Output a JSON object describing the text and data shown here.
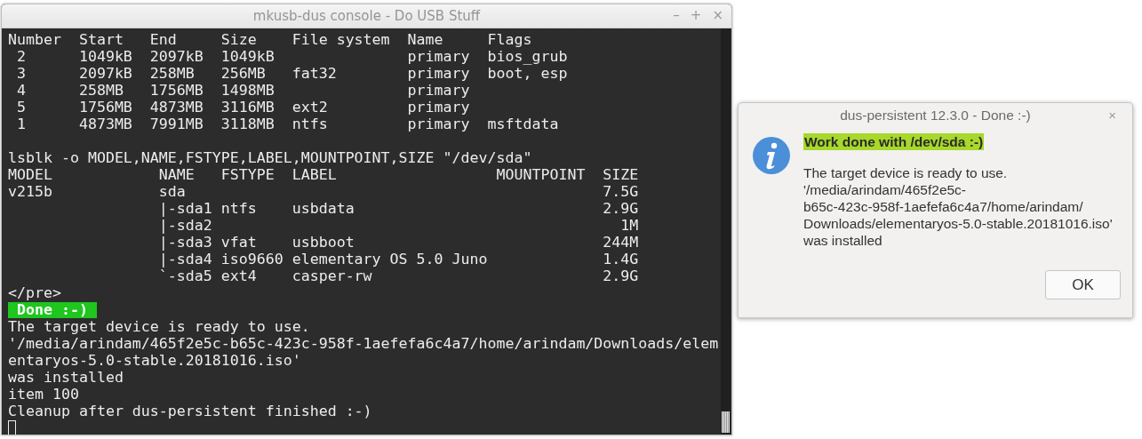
{
  "console": {
    "title": "mkusb-dus console - Do USB Stuff",
    "controls": [
      "–",
      "+",
      "×"
    ],
    "lines": [
      {
        "kind": "text",
        "text": "Number  Start   End     Size    File system  Name     Flags"
      },
      {
        "kind": "text",
        "text": " 2      1049kB  2097kB  1049kB               primary  bios_grub"
      },
      {
        "kind": "text",
        "text": " 3      2097kB  258MB   256MB   fat32        primary  boot, esp"
      },
      {
        "kind": "text",
        "text": " 4      258MB   1756MB  1498MB               primary"
      },
      {
        "kind": "text",
        "text": " 5      1756MB  4873MB  3116MB  ext2         primary"
      },
      {
        "kind": "text",
        "text": " 1      4873MB  7991MB  3118MB  ntfs         primary  msftdata"
      },
      {
        "kind": "blank"
      },
      {
        "kind": "text",
        "text": "lsblk -o MODEL,NAME,FSTYPE,LABEL,MOUNTPOINT,SIZE \"/dev/sda\""
      },
      {
        "kind": "text",
        "text": "MODEL            NAME   FSTYPE  LABEL                  MOUNTPOINT  SIZE"
      },
      {
        "kind": "text",
        "text": "v215b            sda                                               7.5G"
      },
      {
        "kind": "text",
        "text": "                 |-sda1 ntfs    usbdata                            2.9G"
      },
      {
        "kind": "text",
        "text": "                 |-sda2                                              1M"
      },
      {
        "kind": "text",
        "text": "                 |-sda3 vfat    usbboot                            244M"
      },
      {
        "kind": "text",
        "text": "                 |-sda4 iso9660 elementary OS 5.0 Juno             1.4G"
      },
      {
        "kind": "text",
        "text": "                 `-sda5 ext4    casper-rw                          2.9G"
      },
      {
        "kind": "text",
        "text": "</pre>"
      },
      {
        "kind": "badge",
        "text": "Done :-)"
      },
      {
        "kind": "text",
        "text": "The target device is ready to use."
      },
      {
        "kind": "text",
        "text": "'/media/arindam/465f2e5c-b65c-423c-958f-1aefefa6c4a7/home/arindam/Downloads/elem"
      },
      {
        "kind": "text",
        "text": "entaryos-5.0-stable.20181016.iso'"
      },
      {
        "kind": "text",
        "text": "was installed"
      },
      {
        "kind": "text",
        "text": "item 100"
      },
      {
        "kind": "text",
        "text": "Cleanup after dus-persistent finished :-)"
      },
      {
        "kind": "cursor"
      }
    ]
  },
  "dialog": {
    "title": "dus-persistent 12.3.0 - Done :-)",
    "close": "×",
    "heading": "Work done with /dev/sda :-)",
    "body": "The target device is ready to use.\n'/media/arindam/465f2e5c-\nb65c-423c-958f-1aefefa6c4a7/home/arindam/\nDownloads/elementaryos-5.0-stable.20181016.iso'\nwas installed",
    "buttons": [
      "OK"
    ]
  }
}
